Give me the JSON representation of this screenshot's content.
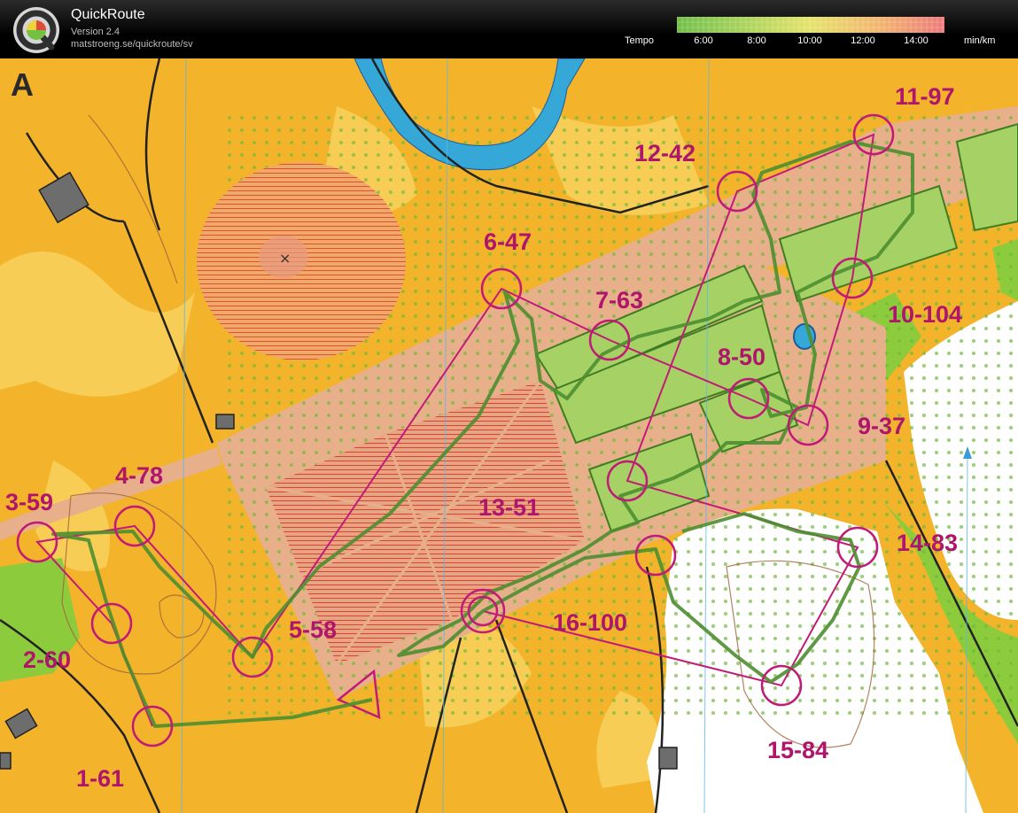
{
  "app": {
    "title": "QuickRoute",
    "version": "Version 2.4",
    "url": "matstroeng.se/quickroute/sv",
    "logo_icon": "quickroute-q-logo-icon"
  },
  "tempo_legend": {
    "label": "Tempo",
    "ticks": [
      "6:00",
      "8:00",
      "10:00",
      "12:00",
      "14:00"
    ],
    "unit": "min/km",
    "colors": [
      "#6fbf4a",
      "#a9d35a",
      "#e6e26a",
      "#f2b66e",
      "#ee7a7a"
    ]
  },
  "map": {
    "sheet_letter": "A",
    "controls": [
      {
        "label": "1-61"
      },
      {
        "label": "2-60"
      },
      {
        "label": "3-59"
      },
      {
        "label": "4-78"
      },
      {
        "label": "5-58"
      },
      {
        "label": "6-47"
      },
      {
        "label": "7-63"
      },
      {
        "label": "8-50"
      },
      {
        "label": "9-37"
      },
      {
        "label": "10-104"
      },
      {
        "label": "11-97"
      },
      {
        "label": "12-42"
      },
      {
        "label": "13-51"
      },
      {
        "label": "14-83"
      },
      {
        "label": "15-84"
      },
      {
        "label": "16-100"
      }
    ],
    "colors": {
      "rough_open": "#f3b32a",
      "open_land": "#f7cd55",
      "paved": "#e7b08a",
      "forest_green": "#8ccb3c",
      "forest_white": "#ffffff",
      "water": "#35a8d8",
      "course_magenta": "#c21a78",
      "route_green": "#4e8e30"
    }
  }
}
